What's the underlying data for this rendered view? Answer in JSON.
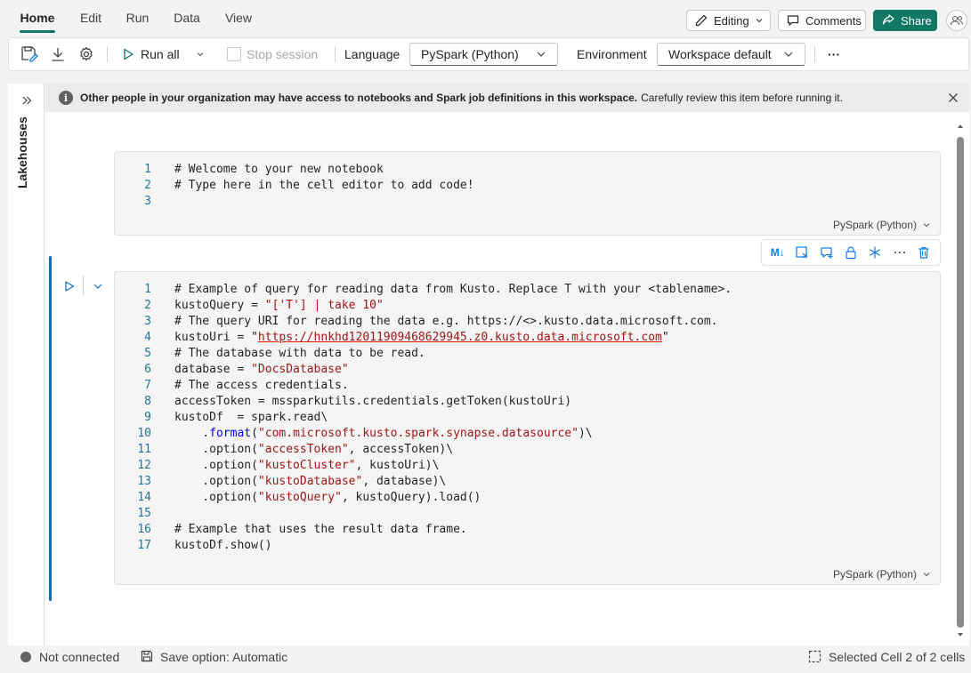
{
  "menu": {
    "tabs": [
      {
        "label": "Home"
      },
      {
        "label": "Edit"
      },
      {
        "label": "Run"
      },
      {
        "label": "Data"
      },
      {
        "label": "View"
      }
    ],
    "editing_label": "Editing",
    "comments_label": "Comments",
    "share_label": "Share"
  },
  "toolbar": {
    "run_all_label": "Run all",
    "stop_session_label": "Stop session",
    "language_label": "Language",
    "language_value": "PySpark (Python)",
    "environment_label": "Environment",
    "environment_value": "Workspace default",
    "more_label": "···"
  },
  "sidebar": {
    "lakehouses_label": "Lakehouses"
  },
  "banner": {
    "bold_text": "Other people in your organization may have access to notebooks and Spark job definitions in this workspace.",
    "rest_text": "Carefully review this item before running it."
  },
  "cell1": {
    "language": "PySpark (Python)",
    "lines": [
      {
        "n": "1",
        "code": "# Welcome to your new notebook"
      },
      {
        "n": "2",
        "code": "# Type here in the cell editor to add code!"
      },
      {
        "n": "3",
        "code": ""
      }
    ]
  },
  "cell_tools": {
    "markdown_label": "M↓"
  },
  "cell2": {
    "language": "PySpark (Python)",
    "lines": [
      {
        "n": "1",
        "code": "# Example of query for reading data from Kusto. Replace T with your <tablename>."
      },
      {
        "n": "2",
        "code": "kustoQuery = \"['T'] | take 10\""
      },
      {
        "n": "3",
        "code": "# The query URI for reading the data e.g. https://<>.kusto.data.microsoft.com."
      },
      {
        "n": "4",
        "code": "kustoUri = \"https://hnkhd12011909468629945.z0.kusto.data.microsoft.com\""
      },
      {
        "n": "5",
        "code": "# The database with data to be read."
      },
      {
        "n": "6",
        "code": "database = \"DocsDatabase\""
      },
      {
        "n": "7",
        "code": "# The access credentials."
      },
      {
        "n": "8",
        "code": "accessToken = mssparkutils.credentials.getToken(kustoUri)"
      },
      {
        "n": "9",
        "code": "kustoDf  = spark.read\\"
      },
      {
        "n": "10",
        "code": "    .format(\"com.microsoft.kusto.spark.synapse.datasource\")\\"
      },
      {
        "n": "11",
        "code": "    .option(\"accessToken\", accessToken)\\"
      },
      {
        "n": "12",
        "code": "    .option(\"kustoCluster\", kustoUri)\\"
      },
      {
        "n": "13",
        "code": "    .option(\"kustoDatabase\", database)\\"
      },
      {
        "n": "14",
        "code": "    .option(\"kustoQuery\", kustoQuery).load()"
      },
      {
        "n": "15",
        "code": ""
      },
      {
        "n": "16",
        "code": "# Example that uses the result data frame."
      },
      {
        "n": "17",
        "code": "kustoDf.show()"
      }
    ]
  },
  "status": {
    "connection": "Not connected",
    "save_option": "Save option: Automatic",
    "selected_cell": "Selected Cell 2 of 2 cells"
  },
  "colors": {
    "accent": "#117865",
    "active_cell": "#0f6cbd",
    "comment": "#008000",
    "string": "#a31515",
    "line_number": "#237893"
  }
}
